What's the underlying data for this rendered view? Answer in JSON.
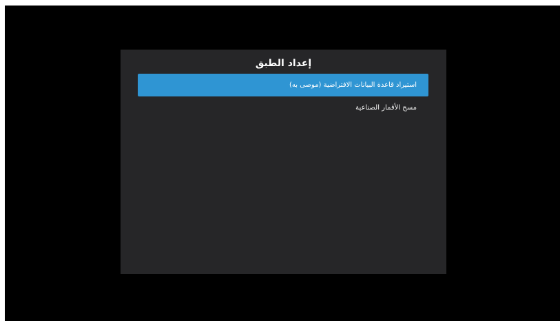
{
  "dialog": {
    "title": "إعداد الطبق",
    "items": [
      {
        "label": "استيراد قاعدة البيانات الافتراضية (موصى به)",
        "selected": true
      },
      {
        "label": "مسح الأقمار الصناعية",
        "selected": false
      }
    ]
  },
  "colors": {
    "background": "#000000",
    "dialog": "#262628",
    "highlight": "#2f95d3",
    "text": "#ffffff"
  }
}
